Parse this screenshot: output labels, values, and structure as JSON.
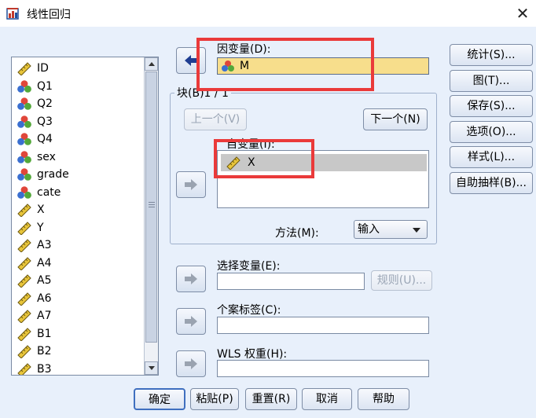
{
  "window": {
    "title": "线性回归",
    "close_glyph": "✕"
  },
  "variables": [
    {
      "name": "ID",
      "type": "scale"
    },
    {
      "name": "Q1",
      "type": "nominal"
    },
    {
      "name": "Q2",
      "type": "nominal"
    },
    {
      "name": "Q3",
      "type": "nominal"
    },
    {
      "name": "Q4",
      "type": "nominal"
    },
    {
      "name": "sex",
      "type": "nominal"
    },
    {
      "name": "grade",
      "type": "nominal"
    },
    {
      "name": "cate",
      "type": "nominal"
    },
    {
      "name": "X",
      "type": "scale"
    },
    {
      "name": "Y",
      "type": "scale"
    },
    {
      "name": "A3",
      "type": "scale"
    },
    {
      "name": "A4",
      "type": "scale"
    },
    {
      "name": "A5",
      "type": "scale"
    },
    {
      "name": "A6",
      "type": "scale"
    },
    {
      "name": "A7",
      "type": "scale"
    },
    {
      "name": "B1",
      "type": "scale"
    },
    {
      "name": "B2",
      "type": "scale"
    },
    {
      "name": "B3",
      "type": "scale"
    }
  ],
  "dependent": {
    "label": "因变量(D):",
    "value": "M"
  },
  "block": {
    "title": "块(B)1 / 1",
    "prev_label": "上一个(V)",
    "next_label": "下一个(N)",
    "independent_label": "自变量(I):",
    "independent_items": [
      "X"
    ],
    "method_label": "方法(M):",
    "method_value": "输入"
  },
  "selection": {
    "label": "选择变量(E):",
    "rule_label": "规则(U)..."
  },
  "case_label": {
    "label": "个案标签(C):"
  },
  "wls": {
    "label": "WLS 权重(H):"
  },
  "side_buttons": [
    "统计(S)...",
    "图(T)...",
    "保存(S)...",
    "选项(O)...",
    "样式(L)...",
    "自助抽样(B)..."
  ],
  "bottom_buttons": [
    "确定",
    "粘贴(P)",
    "重置(R)",
    "取消",
    "帮助"
  ],
  "colors": {
    "highlight": "#ea3a3a",
    "dependent_fill": "#f7de8c",
    "panel_bg": "#e8f0fb"
  }
}
